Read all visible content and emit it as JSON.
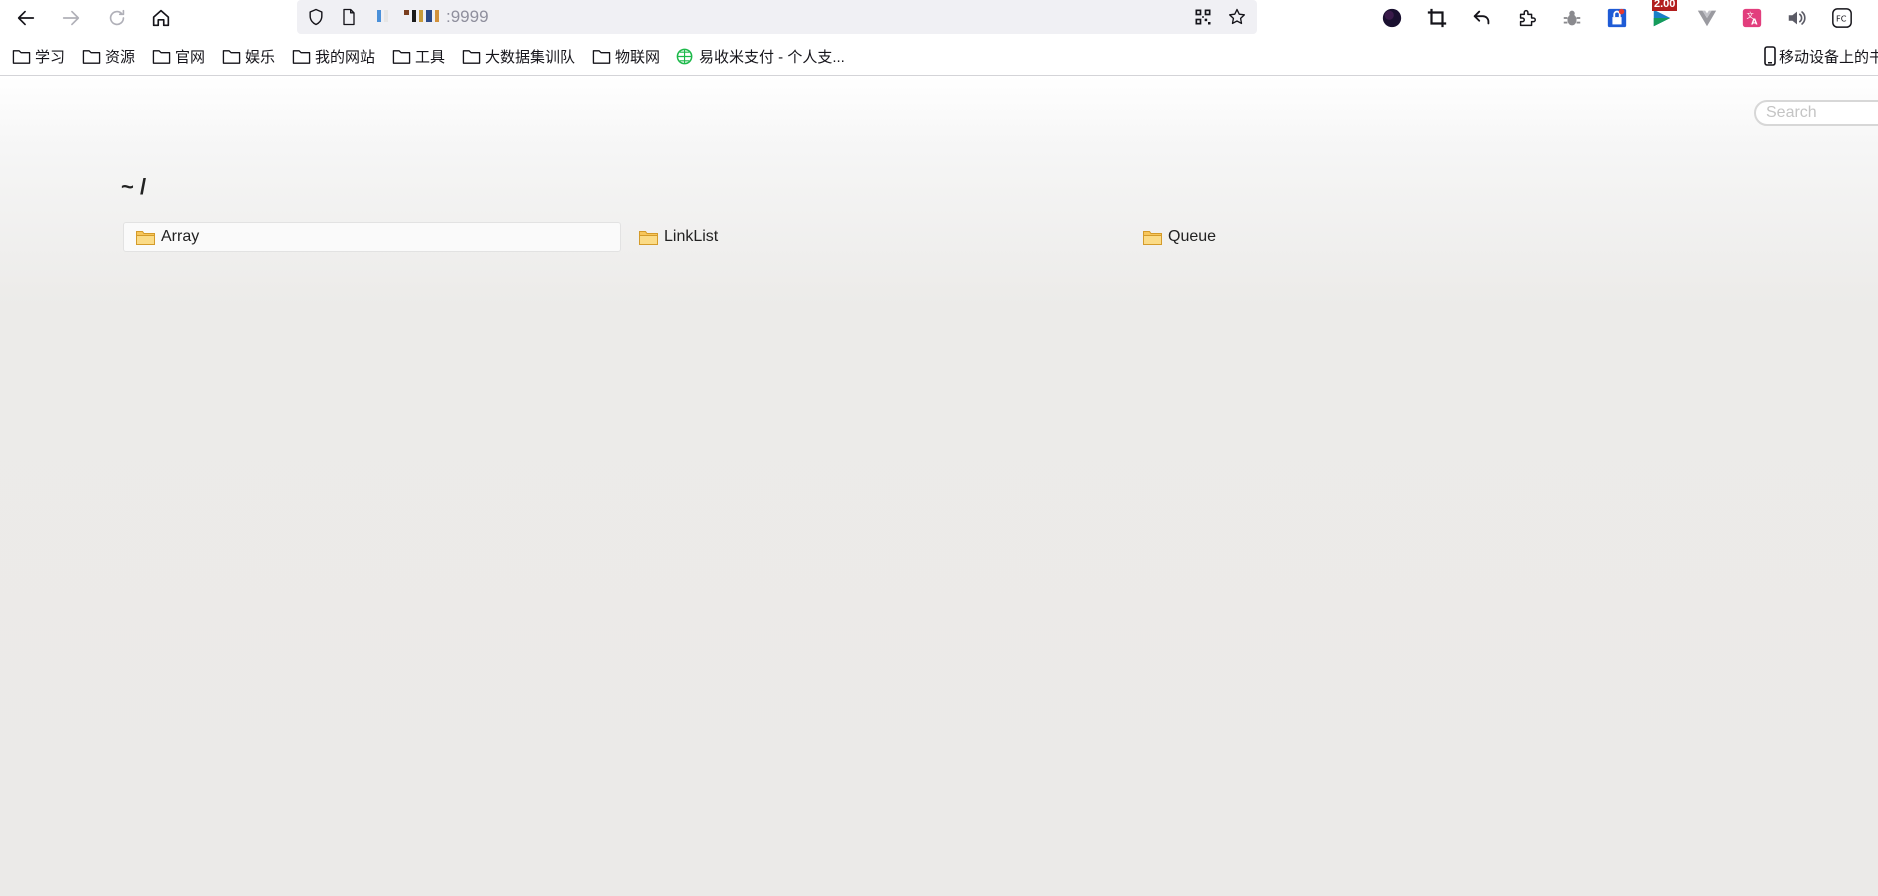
{
  "browser": {
    "url_port": ":9999",
    "url_redact_colors": [
      "#4a90d9",
      "#e6e6e6",
      "#7a3e1f",
      "#1a1a1a",
      "#c79a3a",
      "#2b4a8a"
    ],
    "extension_badge": "2.00"
  },
  "bookmarks": [
    {
      "label": "学习",
      "icon": "folder-icon"
    },
    {
      "label": "资源",
      "icon": "folder-icon"
    },
    {
      "label": "官网",
      "icon": "folder-icon"
    },
    {
      "label": "娱乐",
      "icon": "folder-icon"
    },
    {
      "label": "我的网站",
      "icon": "folder-icon"
    },
    {
      "label": "工具",
      "icon": "folder-icon"
    },
    {
      "label": "大数据集训队",
      "icon": "folder-icon"
    },
    {
      "label": "物联网",
      "icon": "folder-icon"
    },
    {
      "label": "易收米支付 - 个人支...",
      "icon": "globe-icon"
    }
  ],
  "mobile_bookmarks": "移动设备上的书",
  "page": {
    "search_placeholder": "Search",
    "path": "~ /",
    "items": [
      {
        "name": "Array",
        "icon": "folder-icon"
      },
      {
        "name": "LinkList",
        "icon": "folder-icon"
      },
      {
        "name": "Queue",
        "icon": "folder-icon"
      }
    ]
  }
}
